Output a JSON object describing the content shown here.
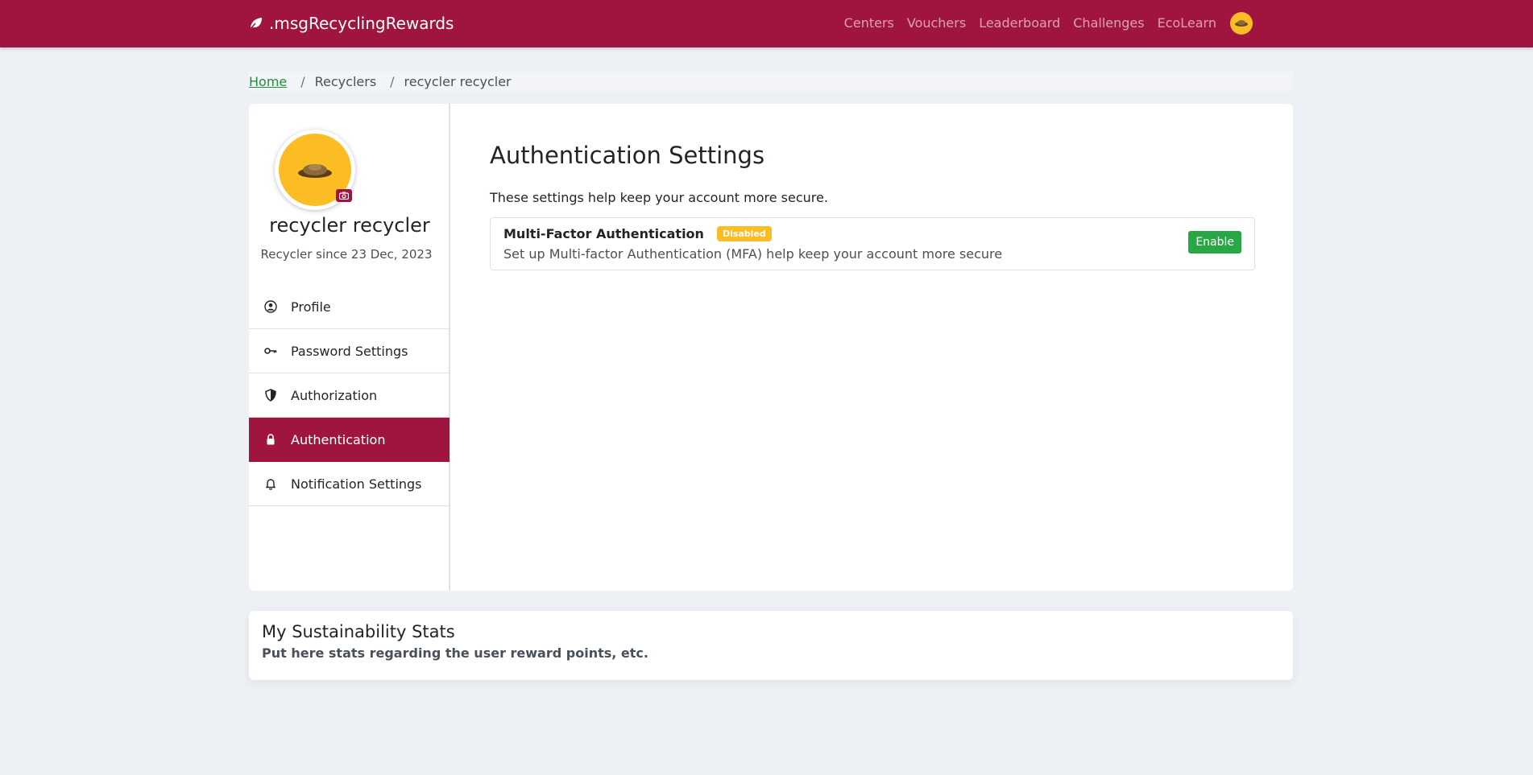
{
  "navbar": {
    "brand": ".msgRecyclingRewards",
    "links": [
      "Centers",
      "Vouchers",
      "Leaderboard",
      "Challenges",
      "EcoLearn"
    ]
  },
  "breadcrumb": {
    "home": "Home",
    "sep": "/",
    "items": [
      "Recyclers",
      "recycler recycler"
    ]
  },
  "profile": {
    "name": "recycler recycler",
    "since": "Recycler since 23 Dec, 2023"
  },
  "menu": [
    {
      "label": "Profile",
      "icon": "user-circle-icon",
      "active": false
    },
    {
      "label": "Password Settings",
      "icon": "key-icon",
      "active": false
    },
    {
      "label": "Authorization",
      "icon": "shield-icon",
      "active": false
    },
    {
      "label": "Authentication",
      "icon": "lock-icon",
      "active": true
    },
    {
      "label": "Notification Settings",
      "icon": "bell-icon",
      "active": false
    }
  ],
  "content": {
    "title": "Authentication Settings",
    "lead": "These settings help keep your account more secure.",
    "mfa": {
      "title": "Multi-Factor Authentication",
      "status": "Disabled",
      "description": "Set up Multi-factor Authentication (MFA) help keep your account more secure",
      "button": "Enable"
    }
  },
  "stats": {
    "title": "My Sustainability Stats",
    "subtitle": "Put here stats regarding the user reward points, etc."
  },
  "colors": {
    "brand": "#a01540",
    "accent": "#fbbc24",
    "success": "#28a745",
    "link": "#1f8f3a"
  }
}
